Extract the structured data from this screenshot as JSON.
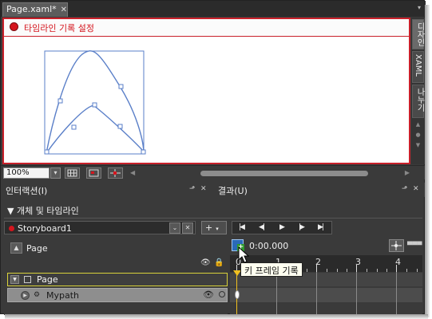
{
  "document_tab": {
    "label": "Page.xaml*",
    "close": "✕"
  },
  "tab_menu": "▾",
  "recording": {
    "label": "타임라인 기록 설정",
    "color": "#d4161e"
  },
  "view_tabs": [
    {
      "label": "디자인",
      "active": true
    },
    {
      "label": "XAML",
      "active": false
    },
    {
      "label": "나누기",
      "active": false
    }
  ],
  "zoom": {
    "value": "100%",
    "dropdown": "▾"
  },
  "panels": {
    "interaction": {
      "title": "인터랙션(I)",
      "pin": "⬏",
      "close": "✕"
    },
    "results": {
      "title": "결과(U)",
      "pin": "⬏",
      "close": "✕"
    }
  },
  "objects_header": "▼ 개체 및 타임라인",
  "storyboard": {
    "name": "Storyboard1",
    "add": "+",
    "add_dropdown": "▾"
  },
  "transport": [
    "|◀",
    "◀|",
    "▶",
    "|▶",
    "▶|"
  ],
  "timeline": {
    "time": "0:00.000",
    "ruler": [
      "0",
      "1",
      "2",
      "3",
      "4"
    ]
  },
  "tree": {
    "root_label": "Page",
    "page_row": {
      "label": "Page",
      "expander": "▼"
    },
    "path_row": {
      "label": "Mypath",
      "expander": "▶"
    }
  },
  "icons": {
    "eye": "👁",
    "lock": "🔒",
    "plus": "+"
  },
  "tooltip": "키 프레임 기록",
  "colors": {
    "accent_red": "#c8202a",
    "selection_yellow": "#d8d03a",
    "playhead": "#f0c020"
  }
}
